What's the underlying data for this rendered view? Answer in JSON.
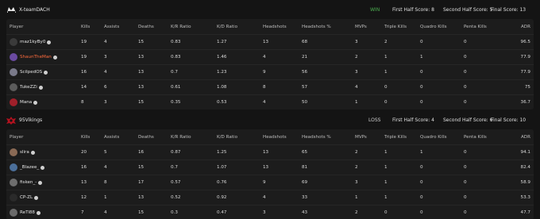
{
  "columns": [
    "Player",
    "Kills",
    "Assists",
    "Deaths",
    "K/R Ratio",
    "K/D Ratio",
    "Headshots",
    "Headshots %",
    "MVPs",
    "Triple Kills",
    "Quadro Kills",
    "Penta Kills",
    "ADR"
  ],
  "team_a": {
    "name": "X-teamDACH",
    "result": "WIN",
    "first_half": "First Half Score: 8",
    "second_half": "Second Half Score: 5",
    "final": "Final Score: 13",
    "players": [
      {
        "name": "maz1kyBy0",
        "stats": [
          "19",
          "4",
          "15",
          "0.83",
          "1.27",
          "13",
          "68",
          "3",
          "2",
          "0",
          "0",
          "96.5"
        ]
      },
      {
        "name": "ShaunTheMan",
        "stats": [
          "19",
          "3",
          "13",
          "0.83",
          "1.46",
          "4",
          "21",
          "2",
          "1",
          "1",
          "0",
          "77.9"
        ]
      },
      {
        "name": "ScilpedOS",
        "stats": [
          "16",
          "4",
          "13",
          "0.7",
          "1.23",
          "9",
          "56",
          "3",
          "1",
          "0",
          "0",
          "77.9"
        ]
      },
      {
        "name": "TukeZZi",
        "stats": [
          "14",
          "6",
          "13",
          "0.61",
          "1.08",
          "8",
          "57",
          "4",
          "0",
          "0",
          "0",
          "75"
        ]
      },
      {
        "name": "Mana",
        "stats": [
          "8",
          "3",
          "15",
          "0.35",
          "0.53",
          "4",
          "50",
          "1",
          "0",
          "0",
          "0",
          "36.7"
        ]
      }
    ]
  },
  "team_b": {
    "name": "95Vikings",
    "result": "LOSS",
    "first_half": "First Half Score: 4",
    "second_half": "Second Half Score: 6",
    "final": "Final Score: 10",
    "players": [
      {
        "name": "slira",
        "stats": [
          "20",
          "5",
          "16",
          "0.87",
          "1.25",
          "13",
          "65",
          "2",
          "1",
          "1",
          "0",
          "94.1"
        ]
      },
      {
        "name": "_Blazee_",
        "stats": [
          "16",
          "4",
          "15",
          "0.7",
          "1.07",
          "13",
          "81",
          "2",
          "1",
          "0",
          "0",
          "82.4"
        ]
      },
      {
        "name": "fisken_-",
        "stats": [
          "13",
          "8",
          "17",
          "0.57",
          "0.76",
          "9",
          "69",
          "3",
          "1",
          "0",
          "0",
          "58.9"
        ]
      },
      {
        "name": "CP-ZL",
        "stats": [
          "12",
          "1",
          "13",
          "0.52",
          "0.92",
          "4",
          "33",
          "1",
          "1",
          "0",
          "0",
          "53.3"
        ]
      },
      {
        "name": "ReTi88",
        "stats": [
          "7",
          "4",
          "15",
          "0.3",
          "0.47",
          "3",
          "43",
          "2",
          "0",
          "0",
          "0",
          "47.7"
        ]
      }
    ]
  },
  "colors": {
    "win": "#4caf50",
    "highlight_player": "#ff6b3d",
    "avatars_a": [
      "#3a3a3a",
      "#6a4aa0",
      "#7a7a8a",
      "#5b5b5b",
      "#a0202a"
    ],
    "avatars_b": [
      "#8a6a55",
      "#4b6f9a",
      "#6d6d6d",
      "#2a2a2a",
      "#6a6a6a"
    ]
  },
  "icons": {
    "team_a_logo": "x-team-logo-icon",
    "team_b_logo": "vikings-logo-icon",
    "verified": "verified-badge-icon"
  }
}
